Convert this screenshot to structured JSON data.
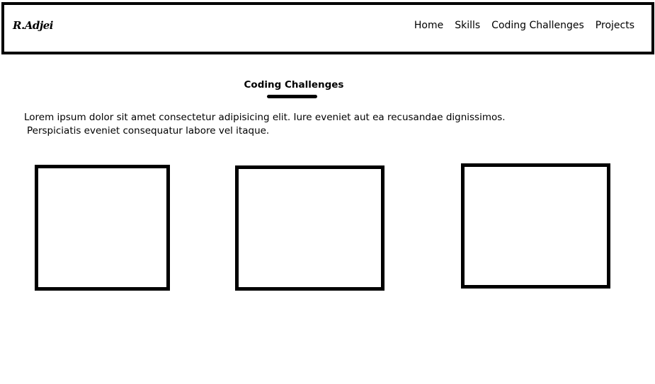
{
  "header": {
    "logo_text": "R.Adjei",
    "nav": [
      {
        "label": "Home"
      },
      {
        "label": "Skills"
      },
      {
        "label": "Coding Challenges"
      },
      {
        "label": "Projects"
      }
    ]
  },
  "section": {
    "title": "Coding Challenges",
    "description_line1": "Lorem ipsum dolor sit amet consectetur adipisicing elit. Iure eveniet aut ea recusandae dignissimos.",
    "description_line2": "Perspiciatis eveniet consequatur labore vel itaque."
  },
  "cards": [
    {
      "label": ""
    },
    {
      "label": ""
    },
    {
      "label": ""
    }
  ],
  "colors": {
    "border": "#000000",
    "background": "#ffffff",
    "text": "#000000"
  }
}
